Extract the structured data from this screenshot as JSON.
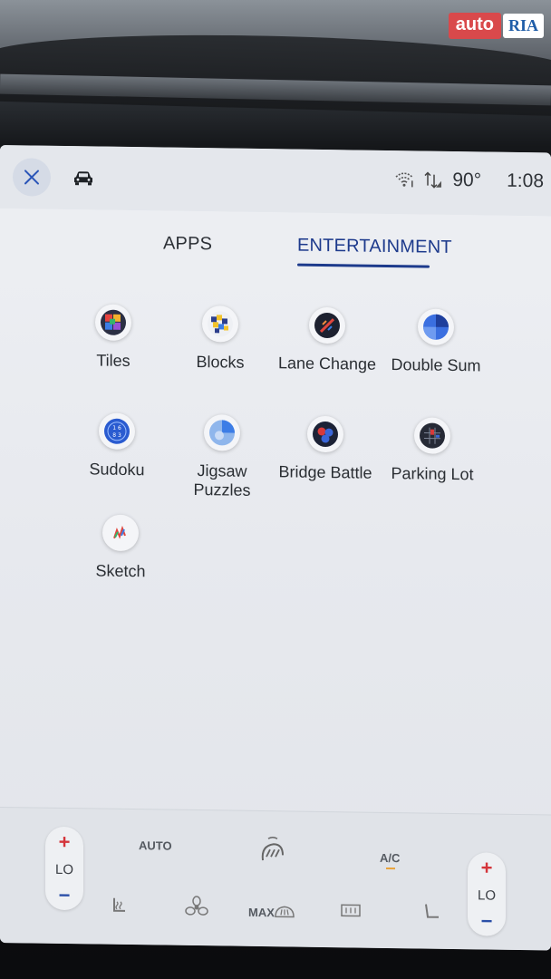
{
  "watermark": {
    "part1": "auto",
    "part2": "RIA"
  },
  "status": {
    "close_icon": "close-icon",
    "vehicle_icon": "car-icon",
    "wifi_icon": "wifi-icon",
    "signal_icon": "signal-icon",
    "temperature": "90°",
    "time": "1:08"
  },
  "tabs": [
    {
      "label": "APPS",
      "active": false
    },
    {
      "label": "ENTERTAINMENT",
      "active": true
    }
  ],
  "apps": [
    {
      "label": "Tiles",
      "icon": "tiles-icon"
    },
    {
      "label": "Blocks",
      "icon": "blocks-icon"
    },
    {
      "label": "Lane Change",
      "icon": "lane-change-icon"
    },
    {
      "label": "Double Sum",
      "icon": "double-sum-icon"
    },
    {
      "label": "Sudoku",
      "icon": "sudoku-icon"
    },
    {
      "label": "Jigsaw Puzzles",
      "line1": "Jigsaw",
      "line2": "Puzzles",
      "icon": "jigsaw-icon"
    },
    {
      "label": "Bridge Battle",
      "icon": "bridge-battle-icon"
    },
    {
      "label": "Parking Lot",
      "icon": "parking-lot-icon"
    },
    {
      "label": "Sketch",
      "icon": "sketch-icon"
    }
  ],
  "climate": {
    "left_temp": "LO",
    "right_temp": "LO",
    "plus": "+",
    "minus": "−",
    "auto": "AUTO",
    "ac": "A/C",
    "max": "MAX",
    "accent_color": "#d4343a"
  },
  "colors": {
    "active_tab": "#1d3a8c",
    "screen_bg": "#e7e9ee"
  }
}
